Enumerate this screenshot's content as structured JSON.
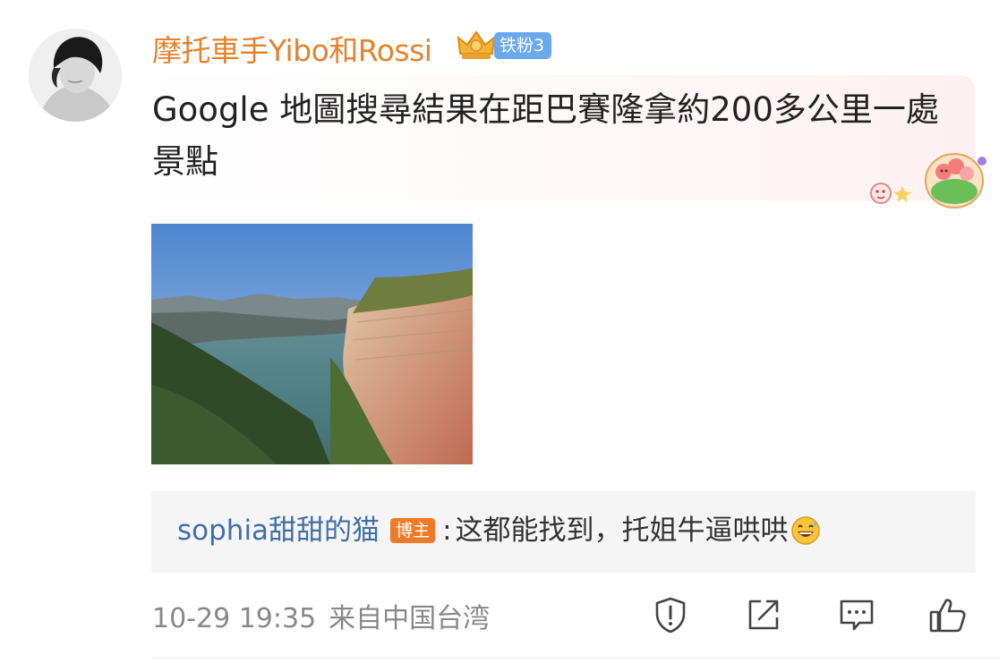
{
  "comment": {
    "username": "摩托車手Yibo和Rossi",
    "fan_badge": "铁粉3",
    "crown_icon": "crown-icon",
    "text": "Google 地圖搜尋結果在距巴賽隆拿約200多公里一處景點",
    "image": "landscape-photo",
    "timestamp": "10-29 19:35",
    "location": "来自中国台湾"
  },
  "reply": {
    "username": "sophia甜甜的猫",
    "badge": "博主",
    "separator": ":",
    "text": "这都能找到，托姐牛逼哄哄",
    "emoji": "grinning-sweat-emoji"
  },
  "actions": [
    "report-icon",
    "share-icon",
    "comment-icon",
    "like-icon"
  ],
  "colors": {
    "username": "#e5822c",
    "fan_badge": "#6aa9ee",
    "reply_username": "#3f6fa8",
    "host_badge": "#f07a27"
  }
}
